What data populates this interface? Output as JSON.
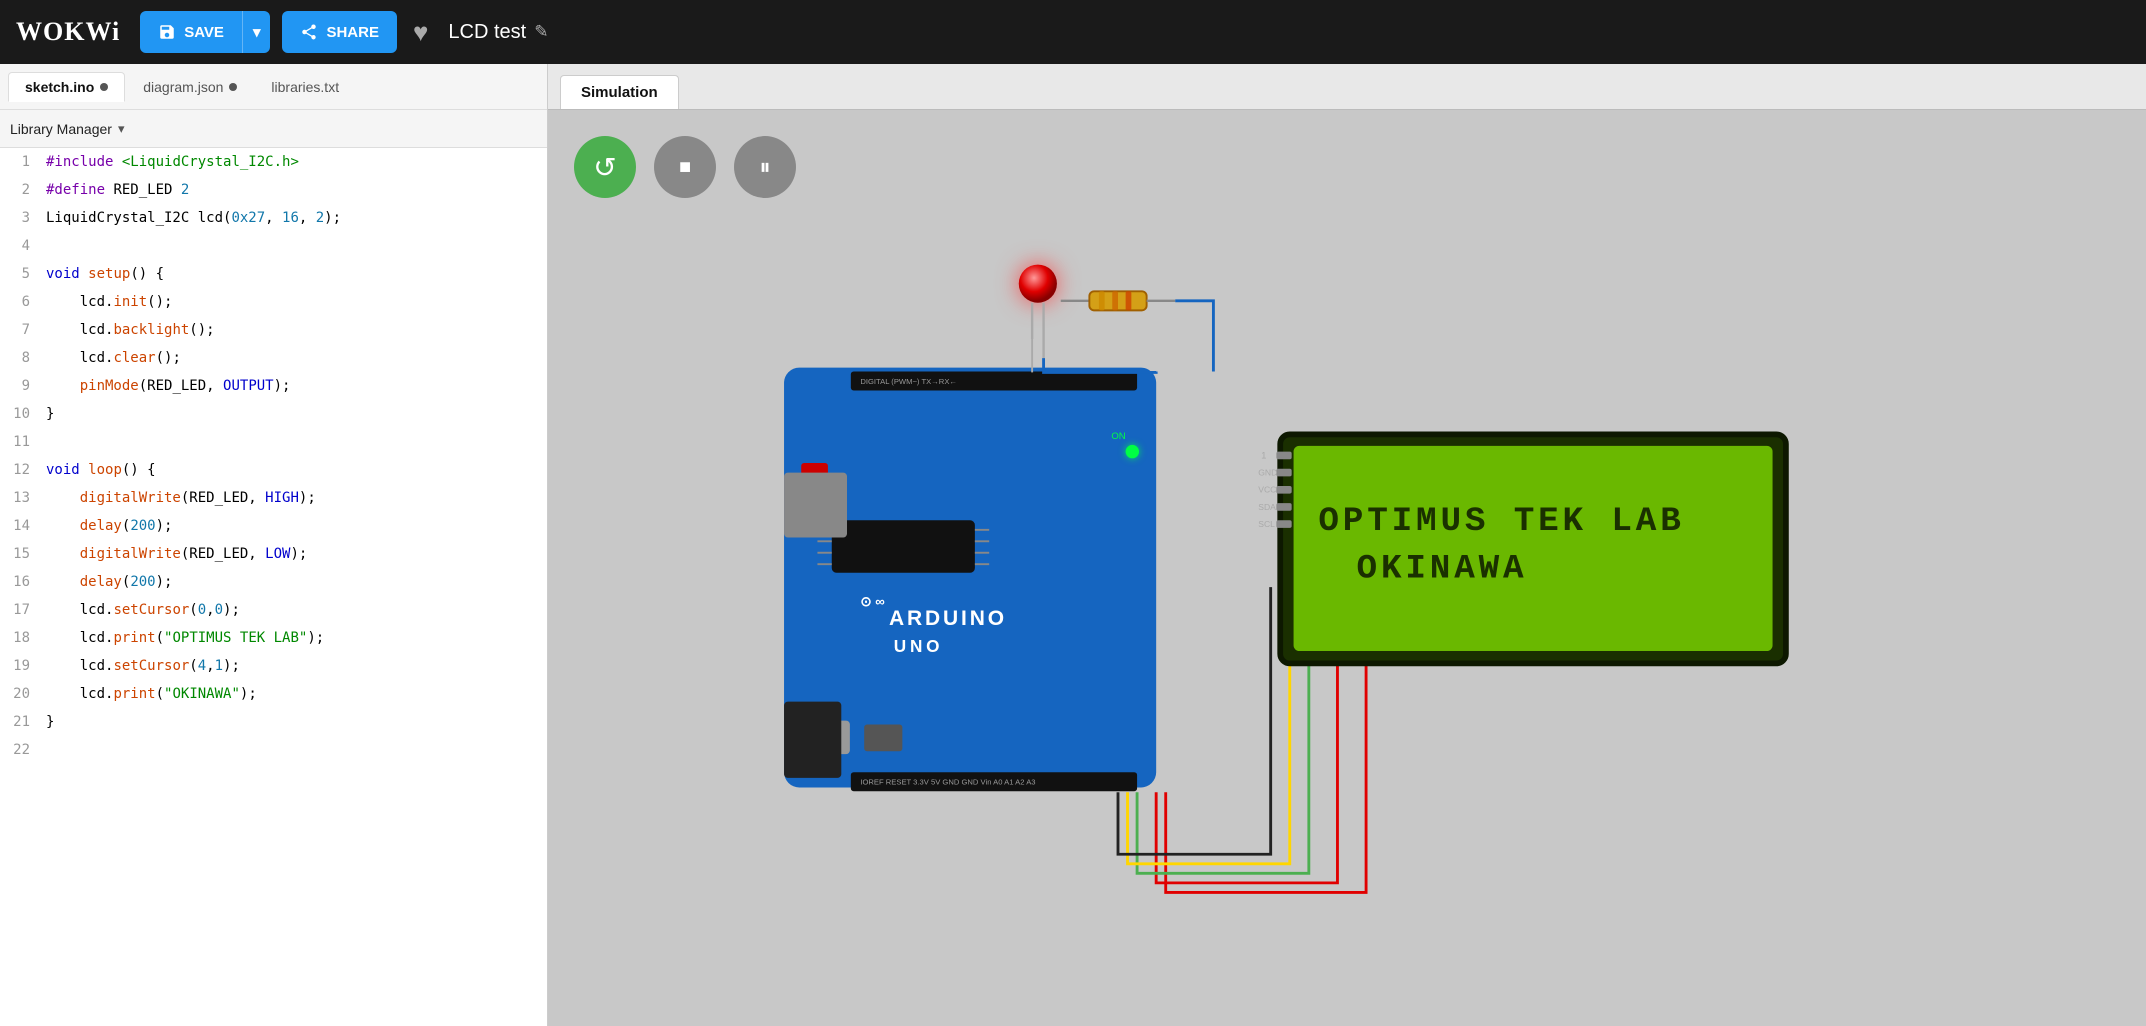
{
  "topnav": {
    "logo": "WOKWi",
    "save_label": "SAVE",
    "share_label": "SHARE",
    "heart_icon": "♥",
    "project_title": "LCD test",
    "pencil_icon": "✎"
  },
  "editor": {
    "tabs": [
      {
        "id": "sketch",
        "label": "sketch.ino",
        "active": true,
        "modified": true
      },
      {
        "id": "diagram",
        "label": "diagram.json",
        "active": false,
        "modified": true
      },
      {
        "id": "libraries",
        "label": "libraries.txt",
        "active": false,
        "modified": false
      }
    ],
    "library_manager_label": "Library Manager",
    "code_lines": [
      {
        "num": 1,
        "tokens": [
          {
            "t": "pp",
            "v": "#include"
          },
          {
            "t": "id",
            "v": " "
          },
          {
            "t": "str",
            "v": "<LiquidCrystal_I2C.h>"
          }
        ]
      },
      {
        "num": 2,
        "tokens": [
          {
            "t": "pp",
            "v": "#define"
          },
          {
            "t": "id",
            "v": " RED_LED "
          },
          {
            "t": "num",
            "v": "2"
          }
        ]
      },
      {
        "num": 3,
        "tokens": [
          {
            "t": "id",
            "v": "LiquidCrystal_I2C lcd("
          },
          {
            "t": "num",
            "v": "0x27"
          },
          {
            "t": "id",
            "v": ", "
          },
          {
            "t": "num",
            "v": "16"
          },
          {
            "t": "id",
            "v": ", "
          },
          {
            "t": "num",
            "v": "2"
          },
          {
            "t": "id",
            "v": ");"
          }
        ]
      },
      {
        "num": 4,
        "tokens": []
      },
      {
        "num": 5,
        "tokens": [
          {
            "t": "kw",
            "v": "void"
          },
          {
            "t": "id",
            "v": " "
          },
          {
            "t": "fn",
            "v": "setup"
          },
          {
            "t": "id",
            "v": "() {"
          }
        ]
      },
      {
        "num": 6,
        "tokens": [
          {
            "t": "id",
            "v": "    lcd."
          },
          {
            "t": "fn",
            "v": "init"
          },
          {
            "t": "id",
            "v": "();"
          }
        ]
      },
      {
        "num": 7,
        "tokens": [
          {
            "t": "id",
            "v": "    lcd."
          },
          {
            "t": "fn",
            "v": "backlight"
          },
          {
            "t": "id",
            "v": "();"
          }
        ]
      },
      {
        "num": 8,
        "tokens": [
          {
            "t": "id",
            "v": "    lcd."
          },
          {
            "t": "fn",
            "v": "clear"
          },
          {
            "t": "id",
            "v": "();"
          }
        ]
      },
      {
        "num": 9,
        "tokens": [
          {
            "t": "fn",
            "v": "    pinMode"
          },
          {
            "t": "id",
            "v": "(RED_LED, "
          },
          {
            "t": "kw",
            "v": "OUTPUT"
          },
          {
            "t": "id",
            "v": ");"
          }
        ]
      },
      {
        "num": 10,
        "tokens": [
          {
            "t": "id",
            "v": "}"
          }
        ]
      },
      {
        "num": 11,
        "tokens": []
      },
      {
        "num": 12,
        "tokens": [
          {
            "t": "kw",
            "v": "void"
          },
          {
            "t": "id",
            "v": " "
          },
          {
            "t": "fn",
            "v": "loop"
          },
          {
            "t": "id",
            "v": "() {"
          }
        ]
      },
      {
        "num": 13,
        "tokens": [
          {
            "t": "fn",
            "v": "    digitalWrite"
          },
          {
            "t": "id",
            "v": "(RED_LED, "
          },
          {
            "t": "kw",
            "v": "HIGH"
          },
          {
            "t": "id",
            "v": ");"
          }
        ]
      },
      {
        "num": 14,
        "tokens": [
          {
            "t": "id",
            "v": "    "
          },
          {
            "t": "fn",
            "v": "delay"
          },
          {
            "t": "id",
            "v": "("
          },
          {
            "t": "num",
            "v": "200"
          },
          {
            "t": "id",
            "v": ");"
          }
        ]
      },
      {
        "num": 15,
        "tokens": [
          {
            "t": "fn",
            "v": "    digitalWrite"
          },
          {
            "t": "id",
            "v": "(RED_LED, "
          },
          {
            "t": "kw",
            "v": "LOW"
          },
          {
            "t": "id",
            "v": ");"
          }
        ]
      },
      {
        "num": 16,
        "tokens": [
          {
            "t": "id",
            "v": "    "
          },
          {
            "t": "fn",
            "v": "delay"
          },
          {
            "t": "id",
            "v": "("
          },
          {
            "t": "num",
            "v": "200"
          },
          {
            "t": "id",
            "v": ");"
          }
        ]
      },
      {
        "num": 17,
        "tokens": [
          {
            "t": "id",
            "v": "    lcd."
          },
          {
            "t": "fn",
            "v": "setCursor"
          },
          {
            "t": "id",
            "v": "("
          },
          {
            "t": "num",
            "v": "0"
          },
          {
            "t": "id",
            "v": ","
          },
          {
            "t": "num",
            "v": "0"
          },
          {
            "t": "id",
            "v": ");"
          }
        ]
      },
      {
        "num": 18,
        "tokens": [
          {
            "t": "id",
            "v": "    lcd."
          },
          {
            "t": "fn",
            "v": "print"
          },
          {
            "t": "id",
            "v": "("
          },
          {
            "t": "str",
            "v": "\"OPTIMUS TEK LAB\""
          },
          {
            "t": "id",
            "v": ");"
          }
        ]
      },
      {
        "num": 19,
        "tokens": [
          {
            "t": "id",
            "v": "    lcd."
          },
          {
            "t": "fn",
            "v": "setCursor"
          },
          {
            "t": "id",
            "v": "("
          },
          {
            "t": "num",
            "v": "4"
          },
          {
            "t": "id",
            "v": ","
          },
          {
            "t": "num",
            "v": "1"
          },
          {
            "t": "id",
            "v": ");"
          }
        ]
      },
      {
        "num": 20,
        "tokens": [
          {
            "t": "id",
            "v": "    lcd."
          },
          {
            "t": "fn",
            "v": "print"
          },
          {
            "t": "id",
            "v": "("
          },
          {
            "t": "str",
            "v": "\"OKINAWA\""
          },
          {
            "t": "id",
            "v": ");"
          }
        ]
      },
      {
        "num": 21,
        "tokens": [
          {
            "t": "id",
            "v": "}"
          }
        ]
      },
      {
        "num": 22,
        "tokens": []
      }
    ]
  },
  "simulation": {
    "tab_label": "Simulation",
    "controls": {
      "restart_icon": "↺",
      "stop_icon": "■",
      "pause_icon": "⏸"
    },
    "lcd": {
      "line1": "OPTIMUS TEK LAB",
      "line2": "OKINAWA"
    }
  }
}
